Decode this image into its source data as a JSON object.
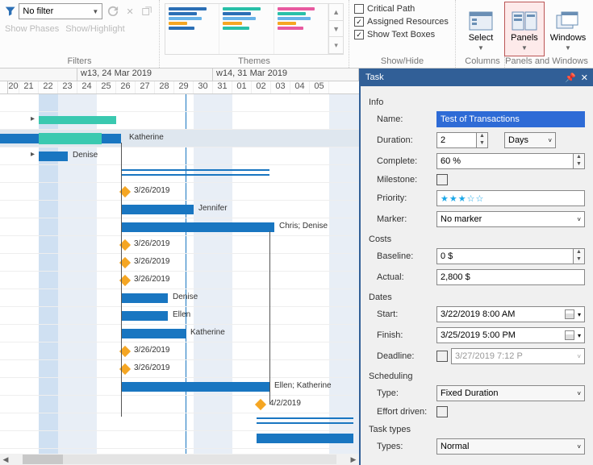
{
  "ribbon": {
    "filter_combo": "No filter",
    "show_phases": "Show Phases",
    "show_highlight": "Show/Highlight",
    "filters_label": "Filters",
    "themes_label": "Themes",
    "showhide_label": "Show/Hide",
    "critical_path": "Critical Path",
    "assigned_resources": "Assigned Resources",
    "show_text_boxes": "Show Text Boxes",
    "select_label": "Select",
    "panels_label": "Panels",
    "windows_label": "Windows",
    "columns_label": "Columns",
    "panels_windows_label": "Panels and Windows"
  },
  "gantt": {
    "week_headers": [
      "w13, 24 Mar 2019",
      "w14, 31 Mar 2019"
    ],
    "day_labels": [
      "20",
      "21",
      "22",
      "23",
      "24",
      "25",
      "26",
      "27",
      "28",
      "29",
      "30",
      "31",
      "01",
      "02",
      "03",
      "04",
      "05"
    ],
    "labels": {
      "katherine": "Katherine",
      "denise": "Denise",
      "jennifer": "Jennifer",
      "chris_denise": "Chris; Denise",
      "ellen": "Ellen",
      "ellen_katherine": "Ellen; Katherine",
      "d326": "3/26/2019",
      "d402": "4/2/2019"
    }
  },
  "task": {
    "title": "Task",
    "info": "Info",
    "name_label": "Name:",
    "name_value": "Test of Transactions",
    "duration_label": "Duration:",
    "duration_value": "2",
    "duration_unit": "Days",
    "complete_label": "Complete:",
    "complete_value": "60 %",
    "milestone_label": "Milestone:",
    "priority_label": "Priority:",
    "priority_stars": "★★★☆☆",
    "marker_label": "Marker:",
    "marker_value": "No marker",
    "costs": "Costs",
    "baseline_label": "Baseline:",
    "baseline_value": "0 $",
    "actual_label": "Actual:",
    "actual_value": "2,800 $",
    "dates": "Dates",
    "start_label": "Start:",
    "start_value": "3/22/2019   8:00 AM",
    "finish_label": "Finish:",
    "finish_value": "3/25/2019   5:00 PM",
    "deadline_label": "Deadline:",
    "deadline_value": "3/27/2019   7:12 P",
    "scheduling": "Scheduling",
    "type_label": "Type:",
    "type_value": "Fixed Duration",
    "effort_label": "Effort driven:",
    "task_types": "Task types",
    "types_label": "Types:",
    "types_value": "Normal"
  }
}
